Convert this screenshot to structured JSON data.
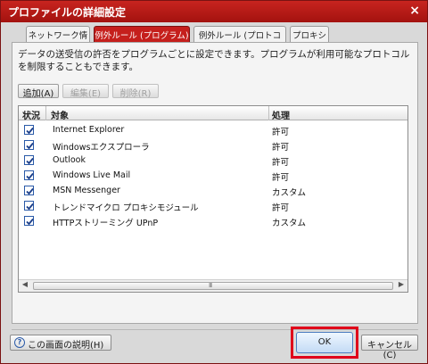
{
  "window": {
    "title": "プロファイルの詳細設定",
    "close_label": "×"
  },
  "tabs": [
    {
      "label": "ネットワーク情報"
    },
    {
      "label": "例外ルール (プログラム)"
    },
    {
      "label": "例外ルール (プロトコル)"
    },
    {
      "label": "プロキシ"
    }
  ],
  "description": "データの送受信の許否をプログラムごとに設定できます。プログラムが利用可能なプロトコルを制限することもできます。",
  "toolbar": {
    "add_label": "追加(A)",
    "edit_label": "編集(E)",
    "delete_label": "削除(R)"
  },
  "list": {
    "headers": {
      "status": "状況",
      "target": "対象",
      "action": "処理"
    },
    "rows": [
      {
        "checked": true,
        "name": "Internet Explorer",
        "action": "許可"
      },
      {
        "checked": true,
        "name": "Windowsエクスプローラ",
        "action": "許可"
      },
      {
        "checked": true,
        "name": "Outlook",
        "action": "許可"
      },
      {
        "checked": true,
        "name": "Windows Live Mail",
        "action": "許可"
      },
      {
        "checked": true,
        "name": "MSN Messenger",
        "action": "カスタム"
      },
      {
        "checked": true,
        "name": "トレンドマイクロ プロキシモジュール",
        "action": "許可"
      },
      {
        "checked": true,
        "name": "HTTPストリーミング UPnP",
        "action": "カスタム"
      }
    ],
    "scroll_grip": "III"
  },
  "footer": {
    "help_label": "この画面の説明(H)",
    "ok_label": "OK",
    "cancel_label": "キャンセル(C)"
  },
  "colors": {
    "accent": "#c51f1c",
    "highlight": "#e0001a"
  }
}
